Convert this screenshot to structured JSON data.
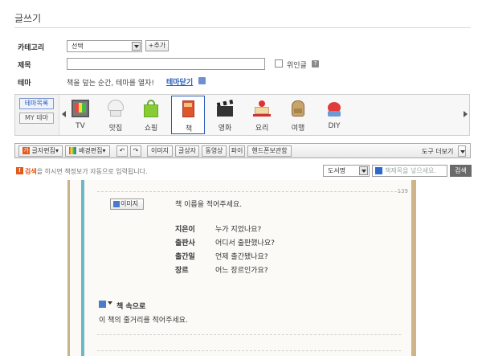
{
  "page": {
    "title": "글쓰기"
  },
  "form": {
    "category_label": "카테고리",
    "category_value": "선택",
    "add_button": "+추가",
    "title_label": "제목",
    "title_value": "",
    "anonymous_label": "위인글",
    "help_label": "?",
    "theme_label": "테마",
    "theme_desc": "책을 덮는 순간, 테마를 열자!",
    "theme_close": "테마닫기"
  },
  "theme": {
    "tabs": [
      "테마목록",
      "MY 테마"
    ],
    "items": [
      {
        "name": "TV",
        "icon": "tv-icon"
      },
      {
        "name": "맛집",
        "icon": "chef-hat-icon"
      },
      {
        "name": "쇼핑",
        "icon": "shopping-bag-icon"
      },
      {
        "name": "책",
        "icon": "book-icon",
        "selected": true
      },
      {
        "name": "영화",
        "icon": "clapperboard-icon"
      },
      {
        "name": "요리",
        "icon": "cake-icon"
      },
      {
        "name": "여행",
        "icon": "backpack-icon"
      },
      {
        "name": "DIY",
        "icon": "pincushion-icon"
      }
    ]
  },
  "toolbar": {
    "text_edit": "글자편집",
    "bg_edit": "배경편집",
    "undo": "↶",
    "redo": "↷",
    "image": "이미지",
    "text_box": "글상자",
    "video": "동영상",
    "file": "파이",
    "mobile_archive": "핸드폰보관함",
    "more_tools": "도구 더보기"
  },
  "search": {
    "notice_prefix": "검색",
    "notice_rest": "을 하시면 책정보가 자동으로 입력됩니다.",
    "type_value": "도서명",
    "placeholder": "책제목을 넣으세요.",
    "button": "검색"
  },
  "book": {
    "page_number": "139",
    "image_button": "이미지",
    "title_prompt": "책 이름을 적어주세요.",
    "fields": [
      {
        "label": "지은이",
        "value": "누가 지었나요?"
      },
      {
        "label": "출판사",
        "value": "어디서 출판했나요?"
      },
      {
        "label": "출간일",
        "value": "언제 출간됐나요?"
      },
      {
        "label": "장르",
        "value": "어느 장르인가요?"
      }
    ],
    "section_title": "책 속으로",
    "section_body": "이 책의 줄거리를 적어주세요."
  },
  "colors": {
    "accent_blue": "#2a5bb8",
    "alert_orange": "#e25a1c"
  }
}
